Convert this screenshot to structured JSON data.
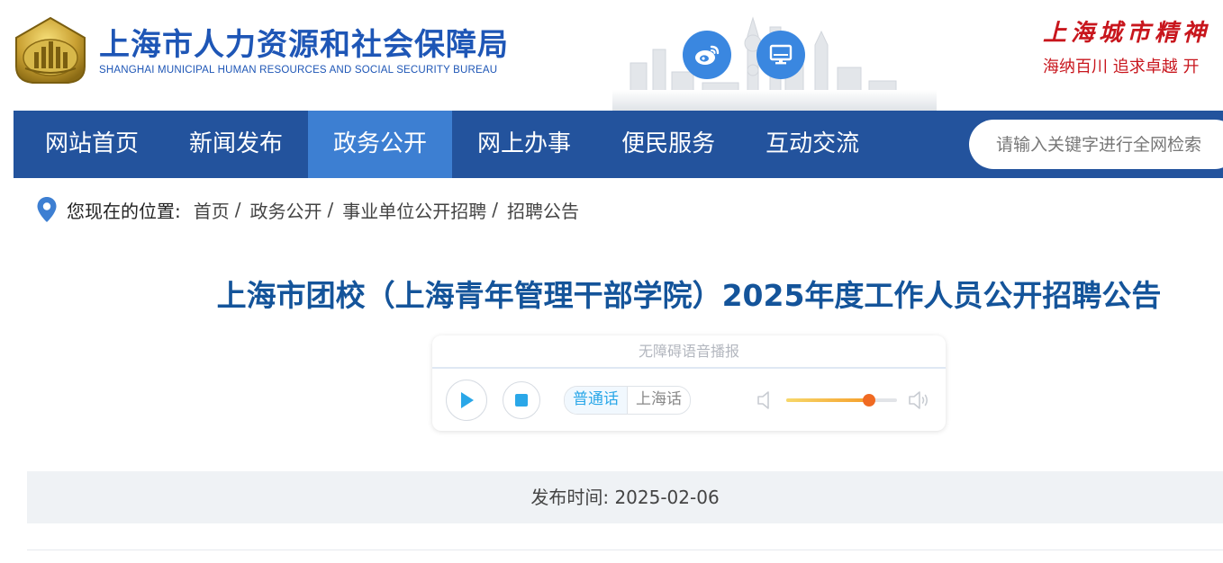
{
  "header": {
    "title": "上海市人力资源和社会保障局",
    "subtitle": "SHANGHAI MUNICIPAL HUMAN RESOURCES AND SOCIAL SECURITY BUREAU",
    "logo_icon": "municipal-emblem-icon",
    "social_icons": [
      "weibo-icon",
      "desktop-icon"
    ],
    "spirit_title": "上海城市精神",
    "spirit_text": "海纳百川  追求卓越  开"
  },
  "nav": {
    "items": [
      {
        "label": "网站首页"
      },
      {
        "label": "新闻发布"
      },
      {
        "label": "政务公开"
      },
      {
        "label": "网上办事"
      },
      {
        "label": "便民服务"
      },
      {
        "label": "互动交流"
      }
    ],
    "active_index": 2,
    "search_placeholder": "请输入关键字进行全网检索"
  },
  "breadcrumb": {
    "label": "您现在的位置:",
    "items": [
      "首页",
      "政务公开",
      "事业单位公开招聘",
      "招聘公告"
    ],
    "separator": "/"
  },
  "article": {
    "title": "上海市团校（上海青年管理干部学院）2025年度工作人员公开招聘公告",
    "publish_label": "发布时间:",
    "publish_date": "2025-02-06"
  },
  "player": {
    "title": "无障碍语音播报",
    "languages": [
      "普通话",
      "上海话"
    ],
    "selected_language": "普通话",
    "volume": 0.75
  },
  "colors": {
    "brand_blue": "#1e56b6",
    "nav_bg": "#23539d",
    "nav_active": "#3d7fd2",
    "spirit_red": "#c8161d",
    "title_blue": "#14549a"
  }
}
